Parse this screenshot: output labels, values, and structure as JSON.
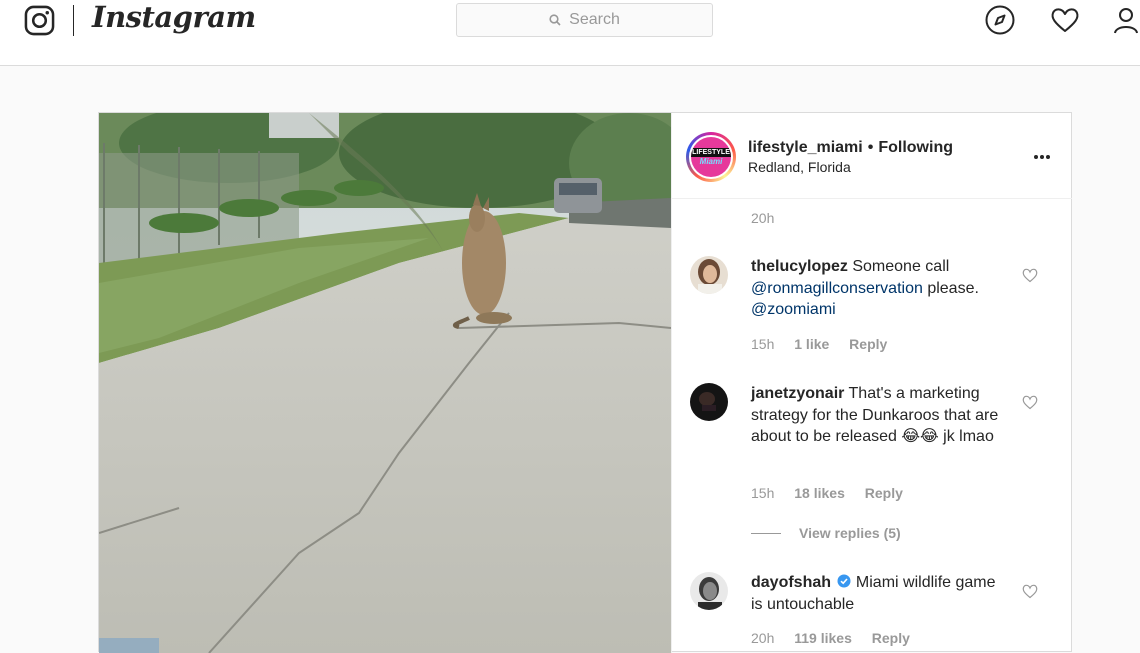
{
  "nav": {
    "wordmark": "Instagram",
    "search_placeholder": "Search",
    "icons": [
      "instagram-logo-icon",
      "search-icon",
      "compass-icon",
      "heart-icon",
      "profile-icon"
    ]
  },
  "post": {
    "username": "lifestyle_miami",
    "separator": "•",
    "follow_status": "Following",
    "location": "Redland, Florida",
    "avatar_text_1": "LIFESTYLE",
    "avatar_text_2": "Miami",
    "caption_time": "20h"
  },
  "comments": [
    {
      "username": "thelucylopez",
      "text_1": "Someone call",
      "mention_1": "@ronmagillconservation",
      "text_2": "please.",
      "mention_2": "@zoomiami",
      "time": "15h",
      "likes": "1 like",
      "reply": "Reply"
    },
    {
      "username": "janetzyonair",
      "text": "That's a marketing strategy for the Dunkaroos that are about to be released 😂😂 jk lmao",
      "time": "15h",
      "likes": "18 likes",
      "reply": "Reply",
      "view_replies": "View replies (5)"
    },
    {
      "username": "dayofshah",
      "verified": true,
      "text": "Miami wildlife game is untouchable",
      "time": "20h",
      "likes": "119 likes",
      "reply": "Reply"
    }
  ],
  "colors": {
    "mention": "#003569",
    "meta": "#999999",
    "border": "#dbdbdb",
    "verified": "#3897f0"
  }
}
